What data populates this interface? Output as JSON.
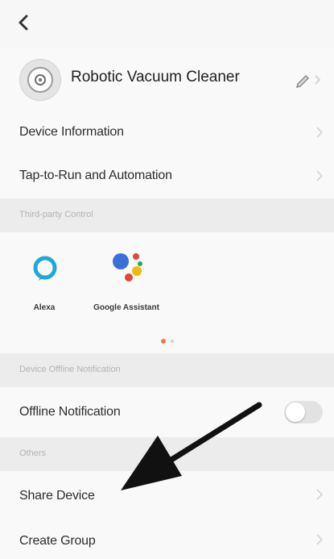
{
  "device": {
    "name": "Robotic Vacuum Cleaner"
  },
  "menu": {
    "device_information": "Device Information",
    "tap_to_run": "Tap-to-Run and Automation",
    "offline_notification": "Offline Notification",
    "share_device": "Share Device",
    "create_group": "Create Group"
  },
  "sections": {
    "third_party_control": "Third-party Control",
    "device_offline_notification": "Device Offline Notification",
    "others": "Others"
  },
  "third_party": [
    {
      "label": "Alexa",
      "icon": "alexa-icon"
    },
    {
      "label": "Google Assistant",
      "icon": "google-assistant-icon"
    }
  ],
  "offline_notification_enabled": false,
  "colors": {
    "accent": "#f07a3a",
    "alexa_blue": "#1fa7d8",
    "annotation_arrow": "#111111"
  },
  "annotation": {
    "icon": "pointer-arrow",
    "target": "share-device"
  }
}
